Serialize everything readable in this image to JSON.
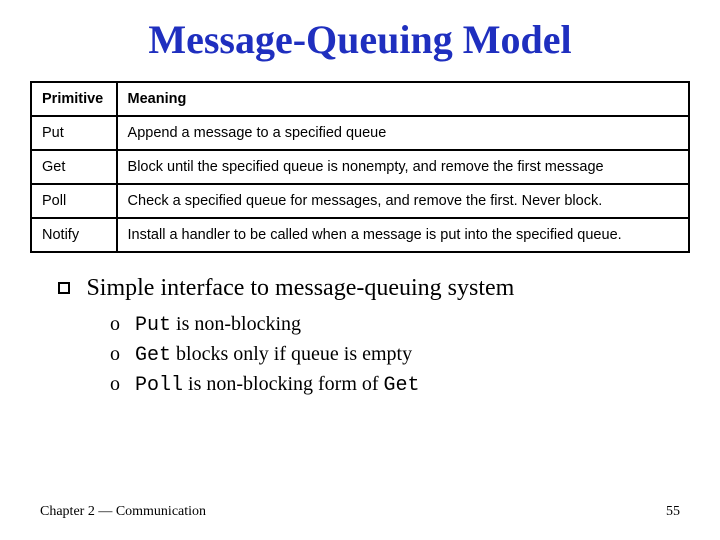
{
  "title": "Message-Queuing Model",
  "table": {
    "headers": {
      "primitive": "Primitive",
      "meaning": "Meaning"
    },
    "rows": [
      {
        "primitive": "Put",
        "meaning": "Append a message to a specified queue"
      },
      {
        "primitive": "Get",
        "meaning": "Block until the specified queue is nonempty, and remove the first message"
      },
      {
        "primitive": "Poll",
        "meaning": "Check a specified queue for messages, and remove the first. Never block."
      },
      {
        "primitive": "Notify",
        "meaning": "Install a handler to be called when a message is put into the specified queue."
      }
    ]
  },
  "bullet": {
    "main": "Simple interface to message-queuing system",
    "subs": [
      {
        "pre": "Put",
        "post": " is non-blocking"
      },
      {
        "pre": "Get",
        "post": " blocks only if queue is empty"
      },
      {
        "pre": "Poll",
        "mid": " is non-blocking form of ",
        "post": "Get"
      }
    ]
  },
  "footer": {
    "left": "Chapter 2 — Communication",
    "right": "55"
  }
}
